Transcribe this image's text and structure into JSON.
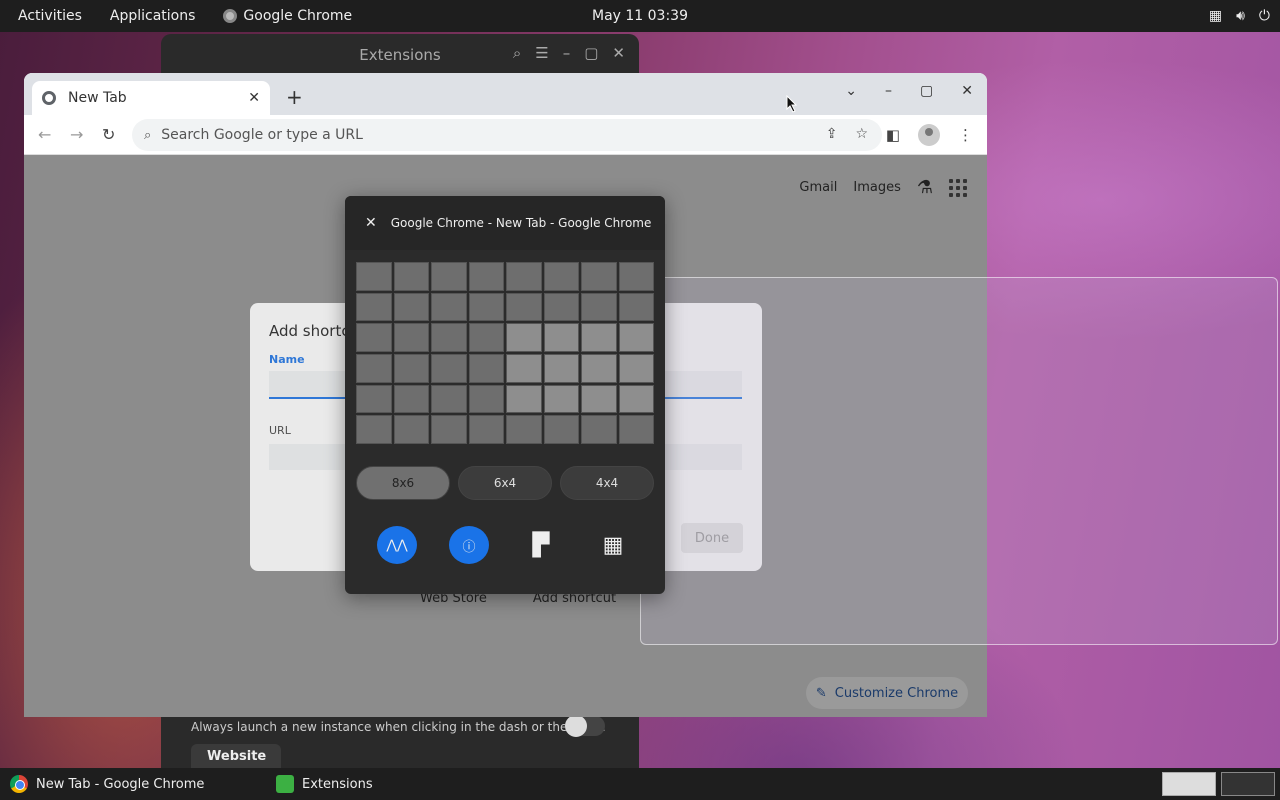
{
  "topbar": {
    "activities": "Activities",
    "applications": "Applications",
    "app_name": "Google Chrome",
    "clock": "May 11  03:39"
  },
  "extensions_window": {
    "title": "Extensions",
    "description": "Always launch a new instance when clicking in the dash or the app…",
    "website_button": "Website"
  },
  "chrome": {
    "tab_title": "New Tab",
    "omnibox_placeholder": "Search Google or type a URL",
    "page": {
      "gmail": "Gmail",
      "images": "Images",
      "shortcut_web_store": "Web Store",
      "shortcut_add": "Add shortcut",
      "customize": "Customize Chrome"
    },
    "dialog": {
      "title": "Add shortcu",
      "name_label": "Name",
      "url_label": "URL",
      "done": "Done"
    }
  },
  "tiler": {
    "title": "Google Chrome - New Tab - Google Chrome",
    "presets": [
      "8x6",
      "6x4",
      "4x4"
    ],
    "active_preset": "8x6"
  },
  "taskbar": {
    "task1": "New Tab - Google Chrome",
    "task2": "Extensions"
  }
}
